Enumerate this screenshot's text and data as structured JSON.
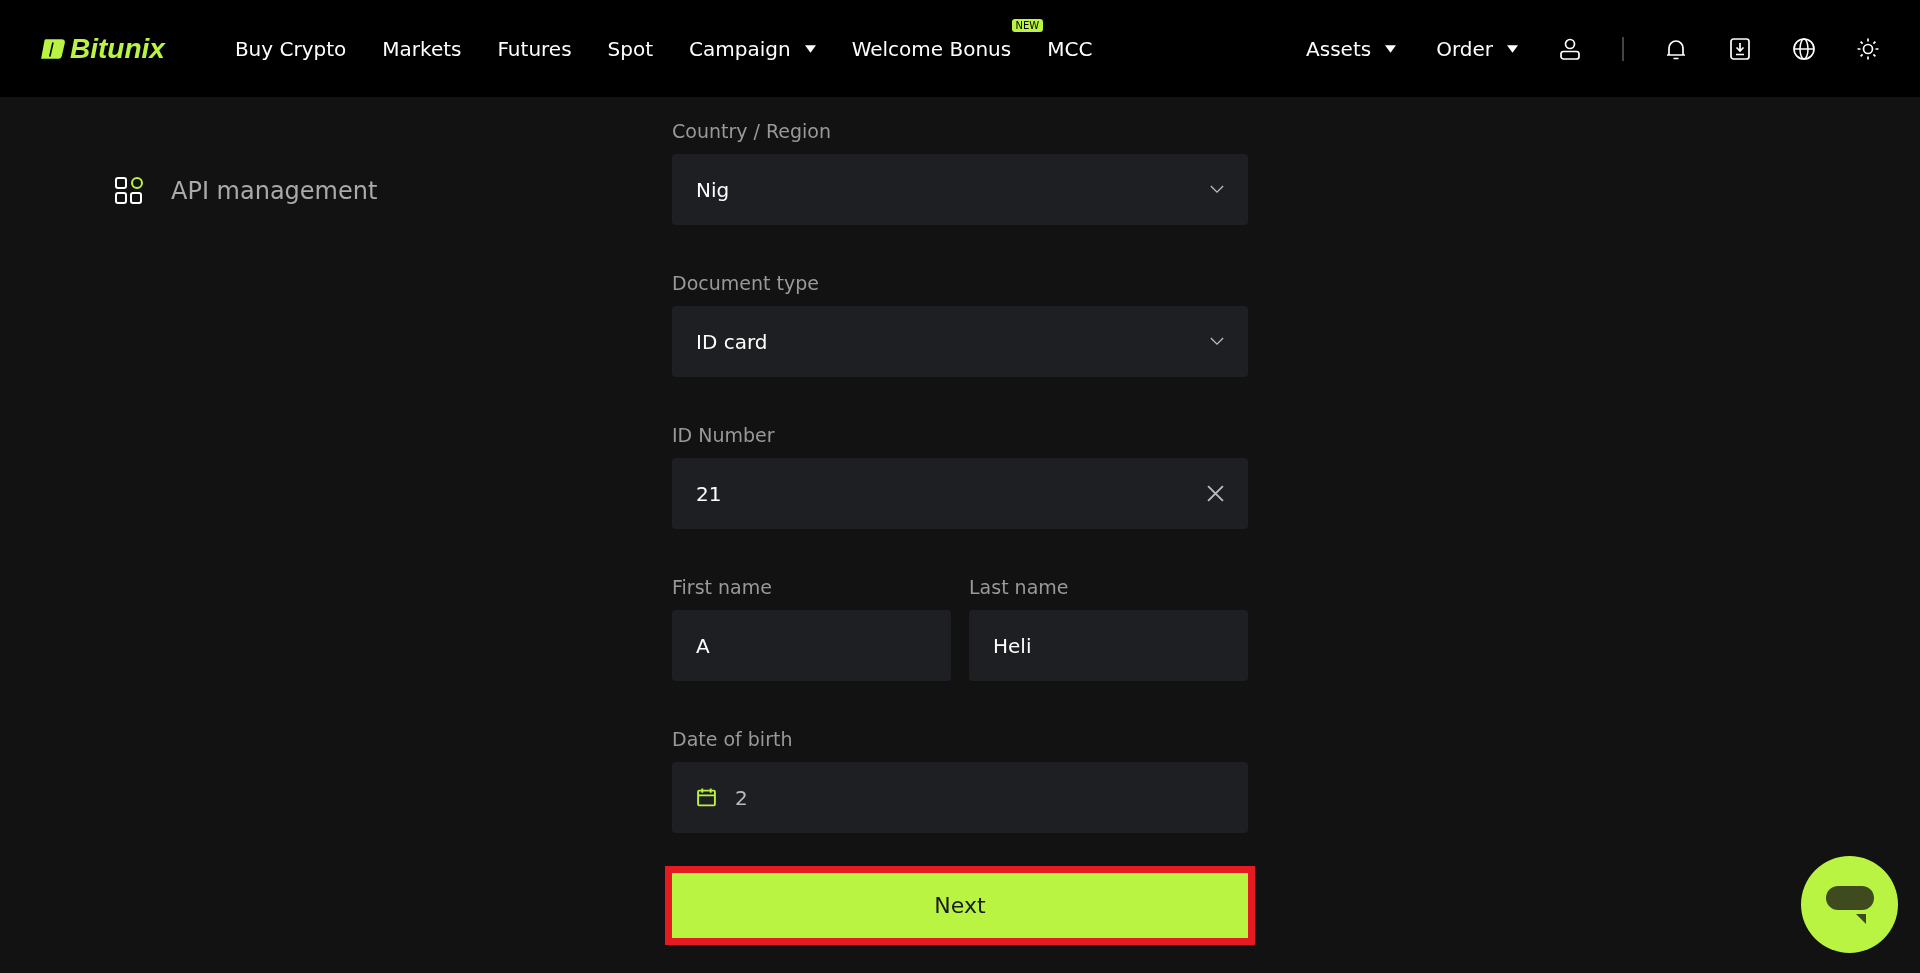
{
  "header": {
    "logo": "Bitunix",
    "nav": [
      {
        "label": "Buy Crypto",
        "dropdown": false
      },
      {
        "label": "Markets",
        "dropdown": false
      },
      {
        "label": "Futures",
        "dropdown": false
      },
      {
        "label": "Spot",
        "dropdown": false
      },
      {
        "label": "Campaign",
        "dropdown": true
      },
      {
        "label": "Welcome Bonus",
        "dropdown": false,
        "badge": "NEW"
      },
      {
        "label": "MCC",
        "dropdown": false
      }
    ],
    "right_menus": [
      {
        "label": "Assets",
        "dropdown": true
      },
      {
        "label": "Order",
        "dropdown": true
      }
    ]
  },
  "sidebar": {
    "items": [
      {
        "label": "API management"
      }
    ]
  },
  "form": {
    "rows": [
      [
        {
          "label": "Country / Region",
          "kind": "select",
          "value": "Nig"
        }
      ],
      [
        {
          "label": "Document type",
          "kind": "select",
          "value": "ID card"
        }
      ],
      [
        {
          "label": "ID Number",
          "kind": "clearable",
          "value": "21"
        }
      ],
      [
        {
          "label": "First name",
          "kind": "text",
          "value": "A"
        },
        {
          "label": "Last name",
          "kind": "text",
          "value": "Heli"
        }
      ],
      [
        {
          "label": "Date of birth",
          "kind": "date",
          "value": "2"
        }
      ]
    ],
    "next_button": {
      "label": "Next",
      "highlighted": true
    }
  }
}
